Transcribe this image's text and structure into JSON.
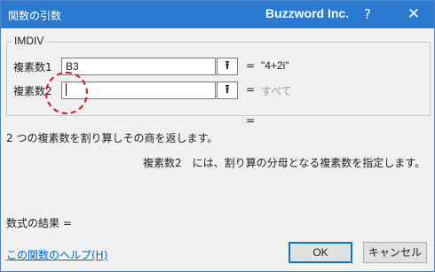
{
  "window": {
    "title": "関数の引数",
    "brand": "Buzzword Inc.",
    "help_icon": "?",
    "close_icon": "✕"
  },
  "function": {
    "name": "IMDIV"
  },
  "arguments": [
    {
      "label": "複素数1",
      "value": "B3",
      "equals": "=",
      "result": "\"4+2i\""
    },
    {
      "label": "複素数2",
      "value": "",
      "equals": "=",
      "result": "すべて"
    }
  ],
  "ref_icon": "⭱",
  "function_result_equals": "=",
  "description": "2 つの複素数を割り算しその商を返します。",
  "argument_help": "複素数2　には、割り算の分母となる複素数を指定します。",
  "formula_result_label": "数式の結果 =",
  "help_link": "この関数のヘルプ(H)",
  "buttons": {
    "ok": "OK",
    "cancel": "キャンセル"
  }
}
